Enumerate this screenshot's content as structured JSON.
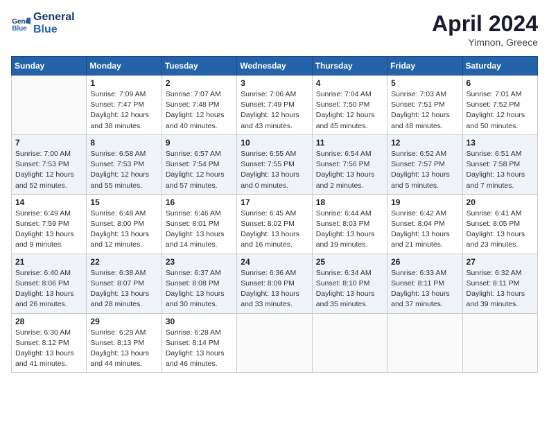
{
  "header": {
    "logo_line1": "General",
    "logo_line2": "Blue",
    "month": "April 2024",
    "location": "Yimnon, Greece"
  },
  "days_of_week": [
    "Sunday",
    "Monday",
    "Tuesday",
    "Wednesday",
    "Thursday",
    "Friday",
    "Saturday"
  ],
  "weeks": [
    [
      {
        "day": "",
        "sunrise": "",
        "sunset": "",
        "daylight": ""
      },
      {
        "day": "1",
        "sunrise": "Sunrise: 7:09 AM",
        "sunset": "Sunset: 7:47 PM",
        "daylight": "Daylight: 12 hours and 38 minutes."
      },
      {
        "day": "2",
        "sunrise": "Sunrise: 7:07 AM",
        "sunset": "Sunset: 7:48 PM",
        "daylight": "Daylight: 12 hours and 40 minutes."
      },
      {
        "day": "3",
        "sunrise": "Sunrise: 7:06 AM",
        "sunset": "Sunset: 7:49 PM",
        "daylight": "Daylight: 12 hours and 43 minutes."
      },
      {
        "day": "4",
        "sunrise": "Sunrise: 7:04 AM",
        "sunset": "Sunset: 7:50 PM",
        "daylight": "Daylight: 12 hours and 45 minutes."
      },
      {
        "day": "5",
        "sunrise": "Sunrise: 7:03 AM",
        "sunset": "Sunset: 7:51 PM",
        "daylight": "Daylight: 12 hours and 48 minutes."
      },
      {
        "day": "6",
        "sunrise": "Sunrise: 7:01 AM",
        "sunset": "Sunset: 7:52 PM",
        "daylight": "Daylight: 12 hours and 50 minutes."
      }
    ],
    [
      {
        "day": "7",
        "sunrise": "Sunrise: 7:00 AM",
        "sunset": "Sunset: 7:53 PM",
        "daylight": "Daylight: 12 hours and 52 minutes."
      },
      {
        "day": "8",
        "sunrise": "Sunrise: 6:58 AM",
        "sunset": "Sunset: 7:53 PM",
        "daylight": "Daylight: 12 hours and 55 minutes."
      },
      {
        "day": "9",
        "sunrise": "Sunrise: 6:57 AM",
        "sunset": "Sunset: 7:54 PM",
        "daylight": "Daylight: 12 hours and 57 minutes."
      },
      {
        "day": "10",
        "sunrise": "Sunrise: 6:55 AM",
        "sunset": "Sunset: 7:55 PM",
        "daylight": "Daylight: 13 hours and 0 minutes."
      },
      {
        "day": "11",
        "sunrise": "Sunrise: 6:54 AM",
        "sunset": "Sunset: 7:56 PM",
        "daylight": "Daylight: 13 hours and 2 minutes."
      },
      {
        "day": "12",
        "sunrise": "Sunrise: 6:52 AM",
        "sunset": "Sunset: 7:57 PM",
        "daylight": "Daylight: 13 hours and 5 minutes."
      },
      {
        "day": "13",
        "sunrise": "Sunrise: 6:51 AM",
        "sunset": "Sunset: 7:58 PM",
        "daylight": "Daylight: 13 hours and 7 minutes."
      }
    ],
    [
      {
        "day": "14",
        "sunrise": "Sunrise: 6:49 AM",
        "sunset": "Sunset: 7:59 PM",
        "daylight": "Daylight: 13 hours and 9 minutes."
      },
      {
        "day": "15",
        "sunrise": "Sunrise: 6:48 AM",
        "sunset": "Sunset: 8:00 PM",
        "daylight": "Daylight: 13 hours and 12 minutes."
      },
      {
        "day": "16",
        "sunrise": "Sunrise: 6:46 AM",
        "sunset": "Sunset: 8:01 PM",
        "daylight": "Daylight: 13 hours and 14 minutes."
      },
      {
        "day": "17",
        "sunrise": "Sunrise: 6:45 AM",
        "sunset": "Sunset: 8:02 PM",
        "daylight": "Daylight: 13 hours and 16 minutes."
      },
      {
        "day": "18",
        "sunrise": "Sunrise: 6:44 AM",
        "sunset": "Sunset: 8:03 PM",
        "daylight": "Daylight: 13 hours and 19 minutes."
      },
      {
        "day": "19",
        "sunrise": "Sunrise: 6:42 AM",
        "sunset": "Sunset: 8:04 PM",
        "daylight": "Daylight: 13 hours and 21 minutes."
      },
      {
        "day": "20",
        "sunrise": "Sunrise: 6:41 AM",
        "sunset": "Sunset: 8:05 PM",
        "daylight": "Daylight: 13 hours and 23 minutes."
      }
    ],
    [
      {
        "day": "21",
        "sunrise": "Sunrise: 6:40 AM",
        "sunset": "Sunset: 8:06 PM",
        "daylight": "Daylight: 13 hours and 26 minutes."
      },
      {
        "day": "22",
        "sunrise": "Sunrise: 6:38 AM",
        "sunset": "Sunset: 8:07 PM",
        "daylight": "Daylight: 13 hours and 28 minutes."
      },
      {
        "day": "23",
        "sunrise": "Sunrise: 6:37 AM",
        "sunset": "Sunset: 8:08 PM",
        "daylight": "Daylight: 13 hours and 30 minutes."
      },
      {
        "day": "24",
        "sunrise": "Sunrise: 6:36 AM",
        "sunset": "Sunset: 8:09 PM",
        "daylight": "Daylight: 13 hours and 33 minutes."
      },
      {
        "day": "25",
        "sunrise": "Sunrise: 6:34 AM",
        "sunset": "Sunset: 8:10 PM",
        "daylight": "Daylight: 13 hours and 35 minutes."
      },
      {
        "day": "26",
        "sunrise": "Sunrise: 6:33 AM",
        "sunset": "Sunset: 8:11 PM",
        "daylight": "Daylight: 13 hours and 37 minutes."
      },
      {
        "day": "27",
        "sunrise": "Sunrise: 6:32 AM",
        "sunset": "Sunset: 8:11 PM",
        "daylight": "Daylight: 13 hours and 39 minutes."
      }
    ],
    [
      {
        "day": "28",
        "sunrise": "Sunrise: 6:30 AM",
        "sunset": "Sunset: 8:12 PM",
        "daylight": "Daylight: 13 hours and 41 minutes."
      },
      {
        "day": "29",
        "sunrise": "Sunrise: 6:29 AM",
        "sunset": "Sunset: 8:13 PM",
        "daylight": "Daylight: 13 hours and 44 minutes."
      },
      {
        "day": "30",
        "sunrise": "Sunrise: 6:28 AM",
        "sunset": "Sunset: 8:14 PM",
        "daylight": "Daylight: 13 hours and 46 minutes."
      },
      {
        "day": "",
        "sunrise": "",
        "sunset": "",
        "daylight": ""
      },
      {
        "day": "",
        "sunrise": "",
        "sunset": "",
        "daylight": ""
      },
      {
        "day": "",
        "sunrise": "",
        "sunset": "",
        "daylight": ""
      },
      {
        "day": "",
        "sunrise": "",
        "sunset": "",
        "daylight": ""
      }
    ]
  ]
}
